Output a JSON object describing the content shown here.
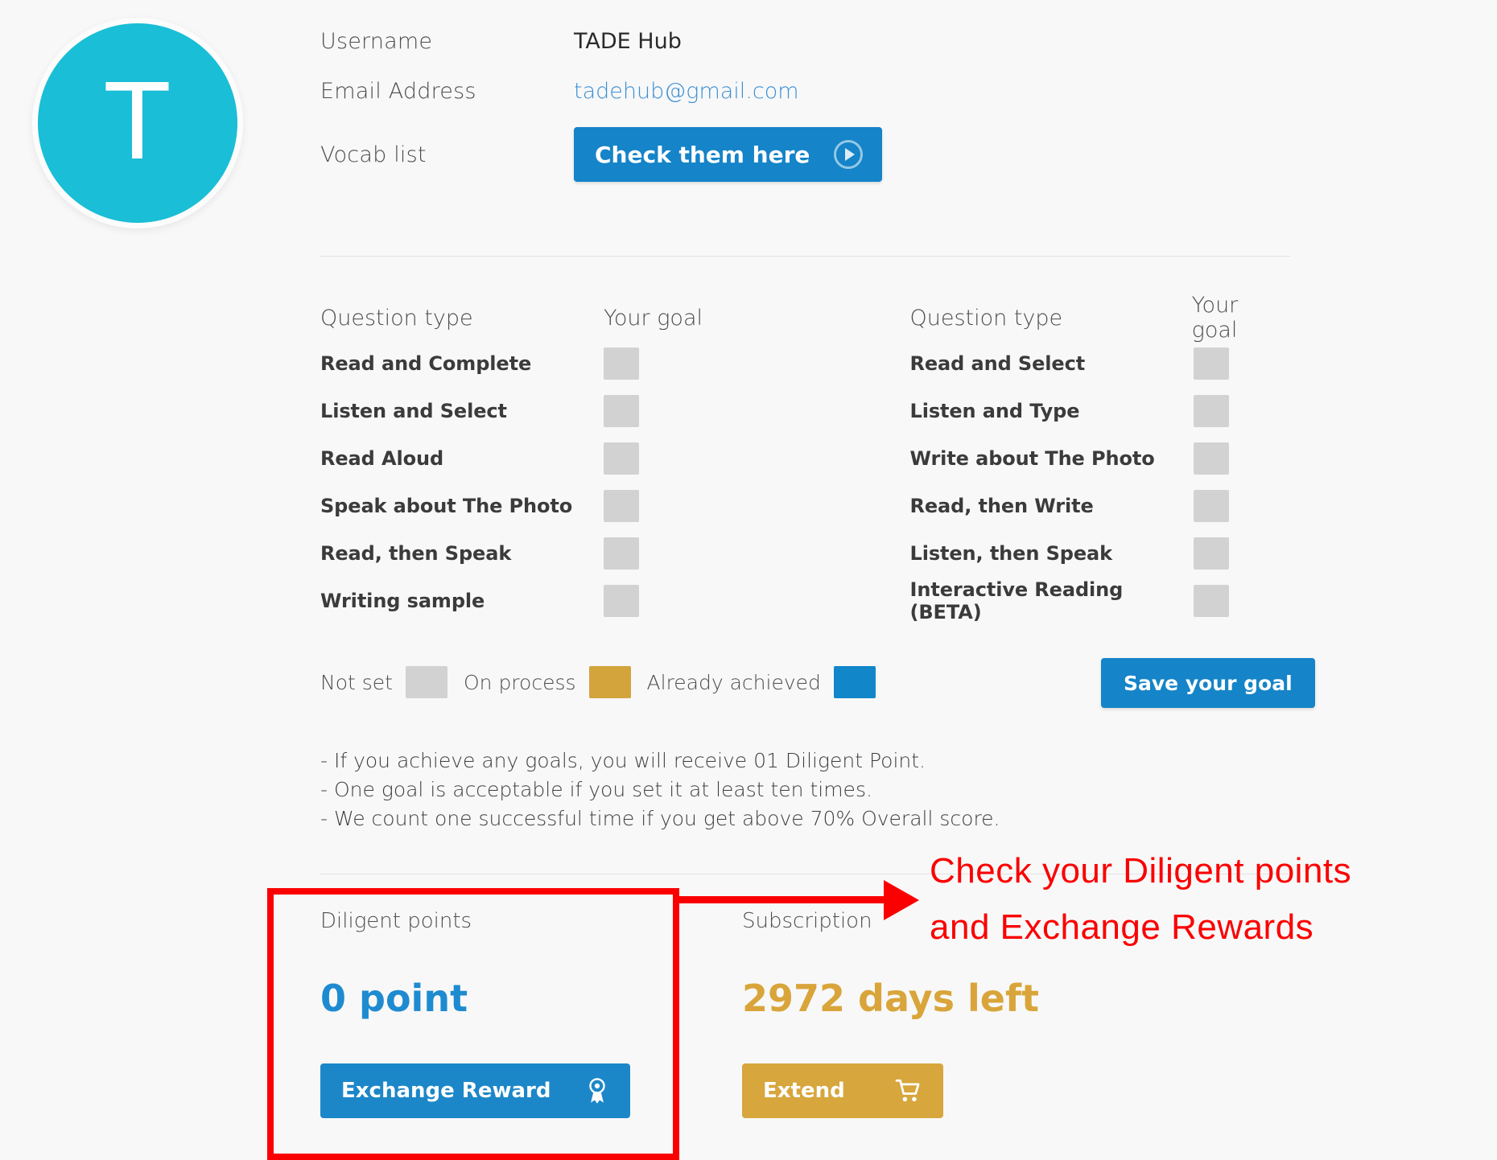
{
  "avatar": {
    "letter": "T",
    "color": "#1abed6"
  },
  "profile": {
    "fields": [
      {
        "label": "Username",
        "value": "TADE Hub"
      },
      {
        "label": "Email Address",
        "value": "tadehub@gmail.com"
      },
      {
        "label": "Vocab list",
        "value": ""
      }
    ],
    "vocab_button_label": "Check them here"
  },
  "goals": {
    "header_type": "Question type",
    "header_goal": "Your goal",
    "left_column": [
      {
        "name": "Read and Complete",
        "state": "not-set"
      },
      {
        "name": "Listen and Select",
        "state": "not-set"
      },
      {
        "name": "Read Aloud",
        "state": "not-set"
      },
      {
        "name": "Speak about The Photo",
        "state": "not-set"
      },
      {
        "name": "Read, then Speak",
        "state": "not-set"
      },
      {
        "name": "Writing sample",
        "state": "not-set"
      }
    ],
    "right_column": [
      {
        "name": "Read and Select",
        "state": "not-set"
      },
      {
        "name": "Listen and Type",
        "state": "not-set"
      },
      {
        "name": "Write about The Photo",
        "state": "not-set"
      },
      {
        "name": "Read, then Write",
        "state": "not-set"
      },
      {
        "name": "Listen, then Speak",
        "state": "not-set"
      },
      {
        "name": "Interactive Reading (BETA)",
        "state": "not-set"
      }
    ],
    "save_label": "Save your goal"
  },
  "legend": {
    "not_set": "Not set",
    "on_process": "On process",
    "already_achieved": "Already achieved",
    "colors": {
      "not_set": "#d2d2d2",
      "on_process": "#d4a43c",
      "already_achieved": "#1187c9"
    }
  },
  "notes": [
    "- If you achieve any goals, you will receive 01 Diligent Point.",
    "- One goal is acceptable if you set it at least ten times.",
    "- We count one successful time if you get above 70% Overall score."
  ],
  "diligent": {
    "title": "Diligent points",
    "value": "0 point",
    "button_label": "Exchange Reward"
  },
  "subscription": {
    "title": "Subscription",
    "value": "2972 days left",
    "button_label": "Extend"
  },
  "annotation": {
    "line1": "Check your Diligent points",
    "line2": "and Exchange Rewards",
    "color": "#fb0000"
  }
}
